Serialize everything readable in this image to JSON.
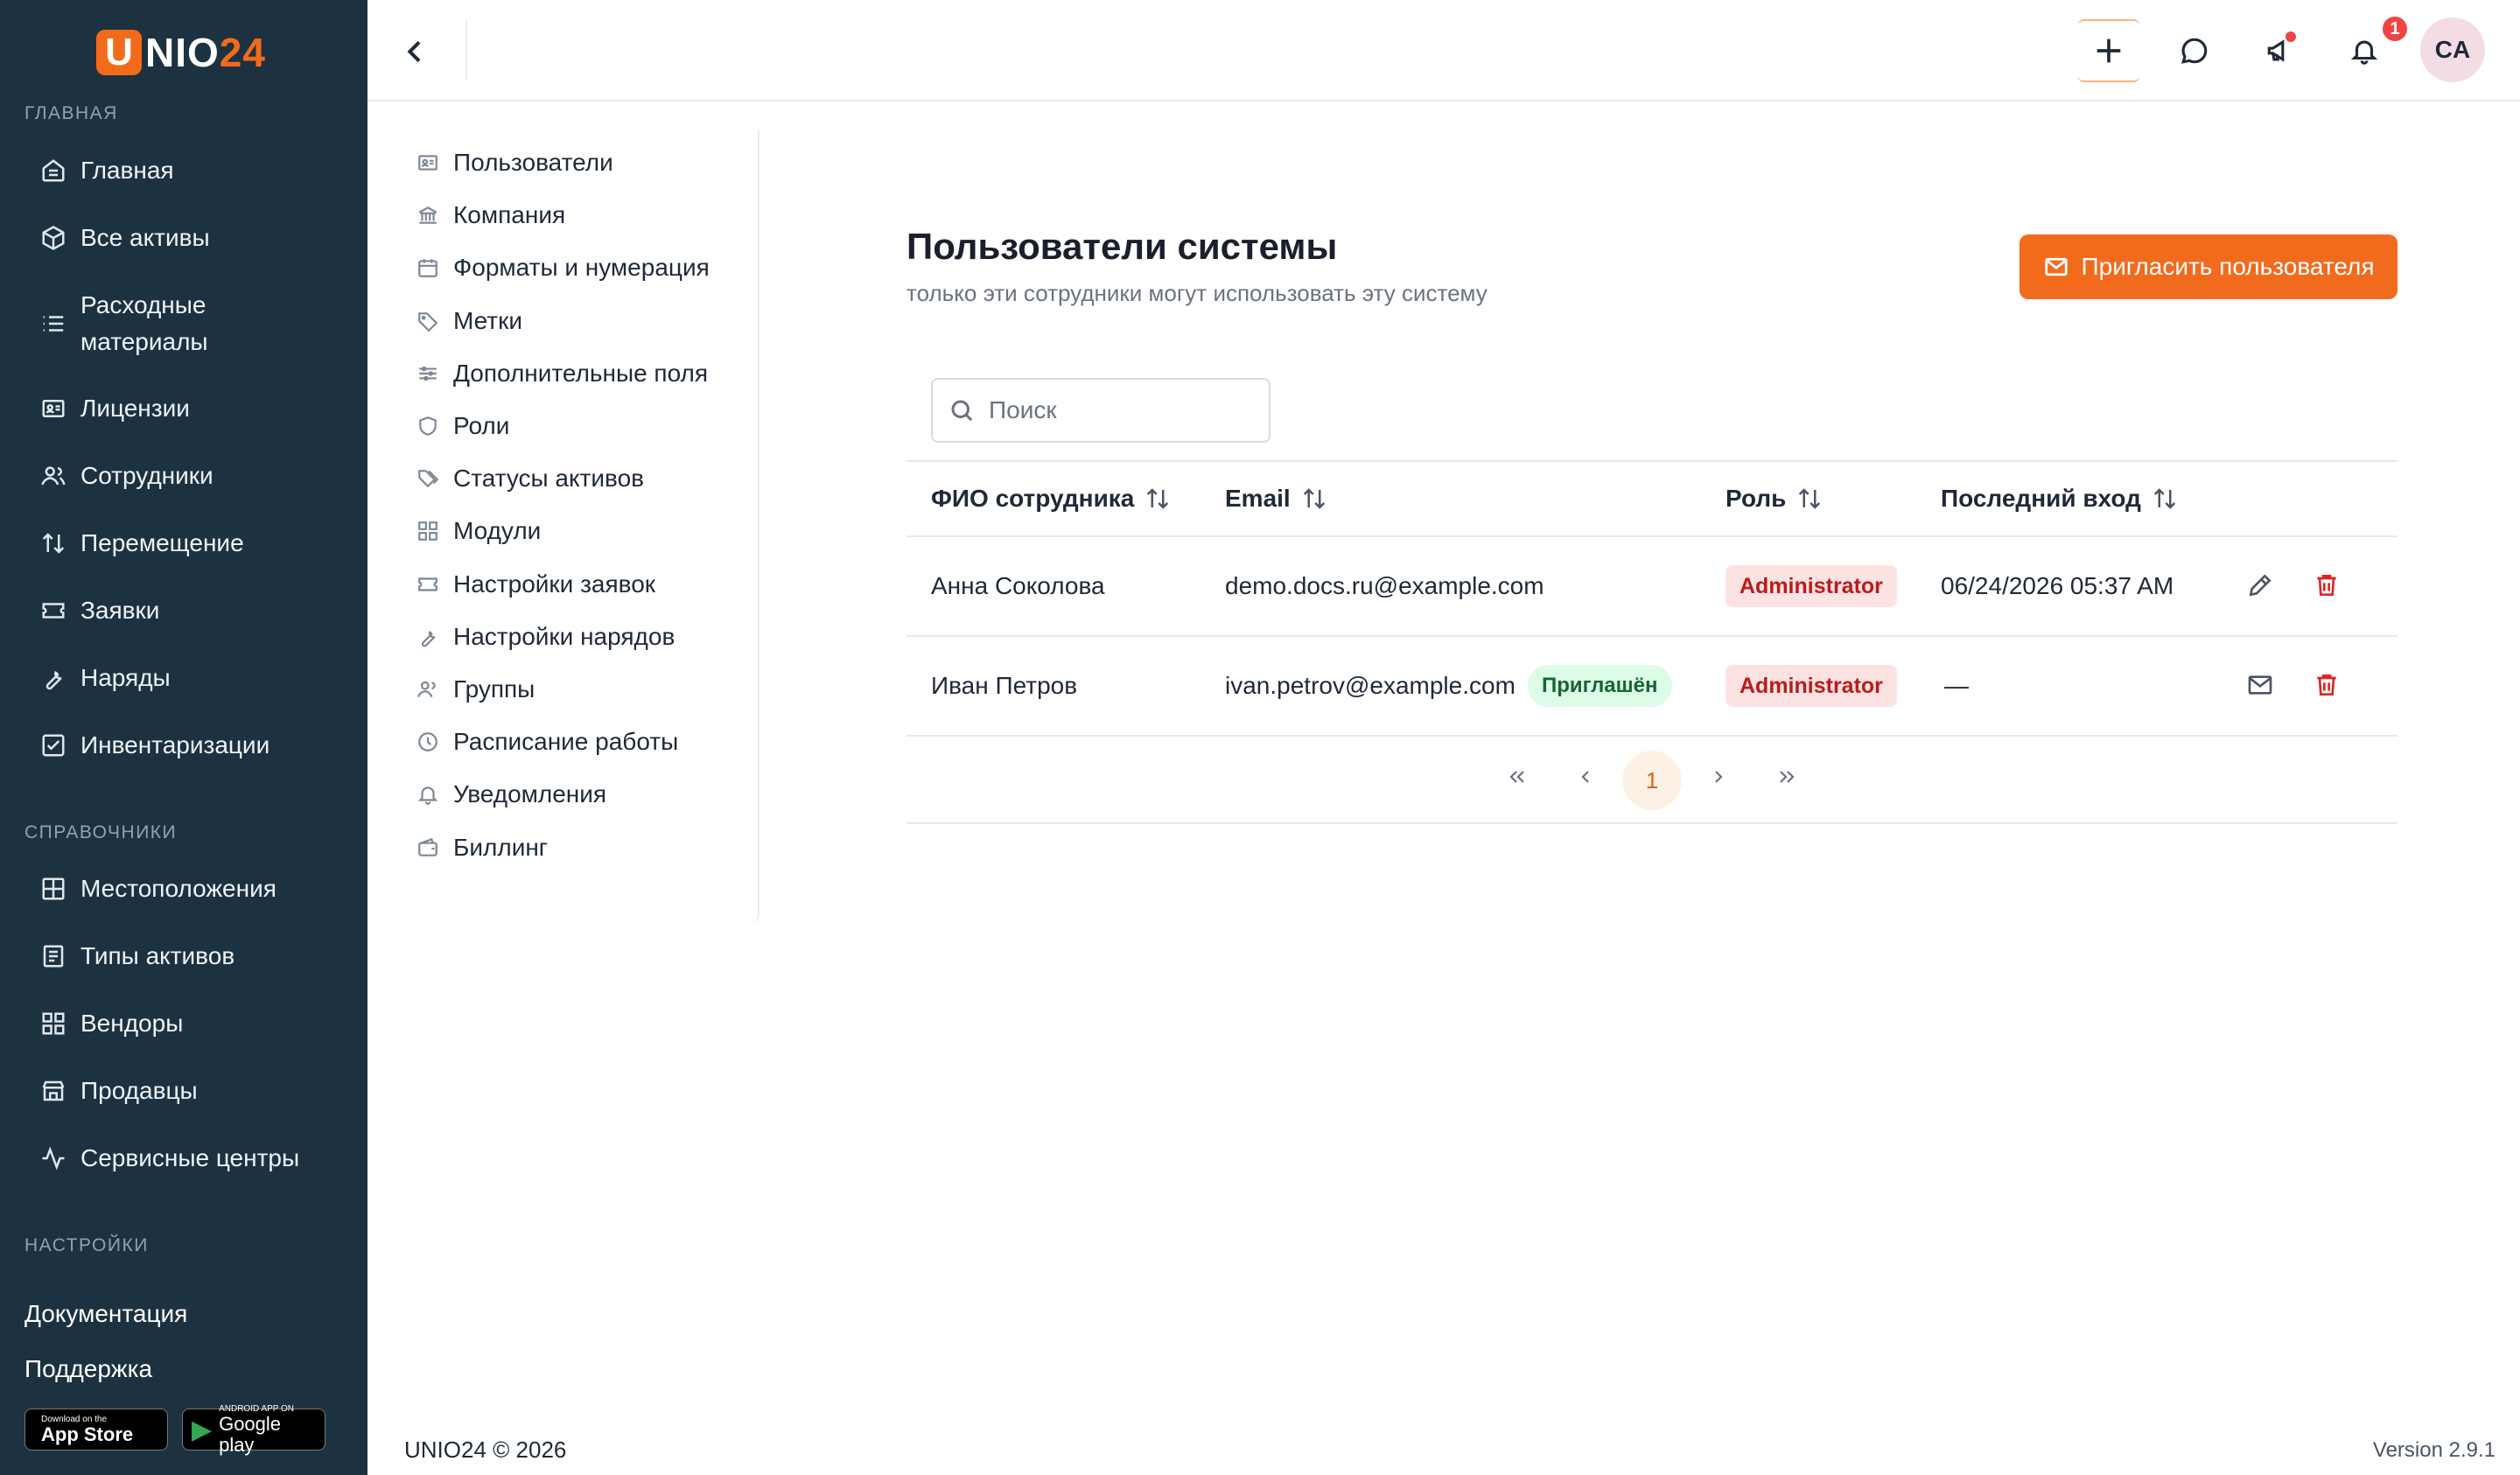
{
  "brand": {
    "logo_letter": "U",
    "logo_text": "NIO",
    "logo_num": "24"
  },
  "sidebar": {
    "sections": [
      "ГЛАВНАЯ",
      "СПРАВОЧНИКИ",
      "НАСТРОЙКИ"
    ],
    "main_items": [
      {
        "label": "Главная",
        "icon": "home-icon"
      },
      {
        "label": "Все активы",
        "icon": "box-icon"
      },
      {
        "label": "Расходные материалы",
        "icon": "list-icon"
      },
      {
        "label": "Лицензии",
        "icon": "id-card-icon"
      },
      {
        "label": "Сотрудники",
        "icon": "users-icon"
      },
      {
        "label": "Перемещение",
        "icon": "arrows-updown-icon"
      },
      {
        "label": "Заявки",
        "icon": "ticket-icon"
      },
      {
        "label": "Наряды",
        "icon": "wrench-icon"
      },
      {
        "label": "Инвентаризации",
        "icon": "checkbox-icon"
      }
    ],
    "ref_items": [
      {
        "label": "Местоположения",
        "icon": "grid-icon"
      },
      {
        "label": "Типы активов",
        "icon": "document-icon"
      },
      {
        "label": "Вендоры",
        "icon": "modules-icon"
      },
      {
        "label": "Продавцы",
        "icon": "store-icon"
      },
      {
        "label": "Сервисные центры",
        "icon": "activity-icon"
      }
    ],
    "footer_links": [
      "Документация",
      "Поддержка"
    ],
    "app_store": {
      "small": "Download on the",
      "big": "App Store"
    },
    "google_play": {
      "small": "ANDROID APP ON",
      "big": "Google play"
    }
  },
  "topbar": {
    "notification_count": "1",
    "avatar_initials": "CA"
  },
  "settings_nav": [
    {
      "label": "Пользователи",
      "icon": "id-card-icon"
    },
    {
      "label": "Компания",
      "icon": "bank-icon"
    },
    {
      "label": "Форматы и нумерация",
      "icon": "calendar-icon"
    },
    {
      "label": "Метки",
      "icon": "tag-icon"
    },
    {
      "label": "Дополнительные поля",
      "icon": "sliders-icon"
    },
    {
      "label": "Роли",
      "icon": "shield-icon"
    },
    {
      "label": "Статусы активов",
      "icon": "tags-icon"
    },
    {
      "label": "Модули",
      "icon": "modules-icon"
    },
    {
      "label": "Настройки заявок",
      "icon": "ticket-icon"
    },
    {
      "label": "Настройки нарядов",
      "icon": "wrench-icon"
    },
    {
      "label": "Группы",
      "icon": "users-icon"
    },
    {
      "label": "Расписание работы",
      "icon": "clock-icon"
    },
    {
      "label": "Уведомления",
      "icon": "bell-icon"
    },
    {
      "label": "Биллинг",
      "icon": "wallet-icon"
    }
  ],
  "main": {
    "title": "Пользователи системы",
    "subtitle": "только эти сотрудники могут использовать эту систему",
    "invite_button": "Пригласить пользователя",
    "search_placeholder": "Поиск",
    "columns": [
      "ФИО сотрудника",
      "Email",
      "Роль",
      "Последний вход"
    ],
    "rows": [
      {
        "name": "Анна Соколова",
        "email": "demo.docs.ru@example.com",
        "status": "",
        "role": "Administrator",
        "last_login": "06/24/2026 05:37 AM"
      },
      {
        "name": "Иван Петров",
        "email": "ivan.petrov@example.com",
        "status": "Приглашён",
        "role": "Administrator",
        "last_login": "—"
      }
    ],
    "pagination": {
      "current_page": "1"
    }
  },
  "footer": {
    "copyright": "UNIO24 © 2026",
    "version": "Version 2.9.1"
  },
  "colors": {
    "sidebar_bg": "#1d3240",
    "accent": "#f26b1d",
    "danger": "#dc2626",
    "success_bg": "#dcfce7"
  }
}
